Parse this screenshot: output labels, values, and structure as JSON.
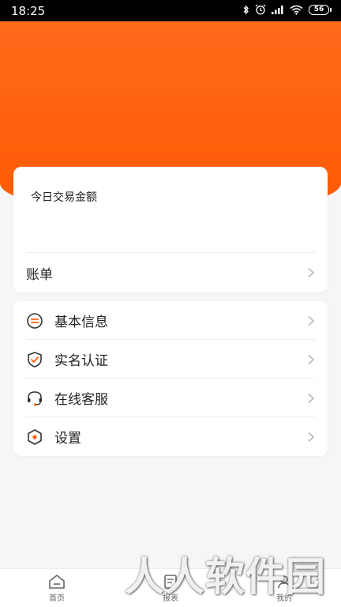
{
  "status_bar": {
    "time": "18:25",
    "battery": "56",
    "icons": [
      "bluetooth-icon",
      "alarm-icon",
      "signal-icon",
      "wifi-icon",
      "battery-icon"
    ]
  },
  "colors": {
    "accent": "#ff5f0f",
    "background": "#f5f6f8",
    "card": "#ffffff"
  },
  "summary": {
    "amount_label": "今日交易金额"
  },
  "bill": {
    "label": "账单"
  },
  "menu": {
    "items": [
      {
        "label": "基本信息",
        "icon": "info-icon"
      },
      {
        "label": "实名认证",
        "icon": "shield-check-icon"
      },
      {
        "label": "在线客服",
        "icon": "headset-icon"
      },
      {
        "label": "设置",
        "icon": "settings-hex-icon"
      }
    ]
  },
  "tabbar": {
    "tabs": [
      {
        "label": "首页",
        "icon": "home-icon"
      },
      {
        "label": "报表",
        "icon": "report-icon"
      },
      {
        "label": "我的",
        "icon": "profile-icon"
      }
    ]
  },
  "watermark": "人人软件园"
}
